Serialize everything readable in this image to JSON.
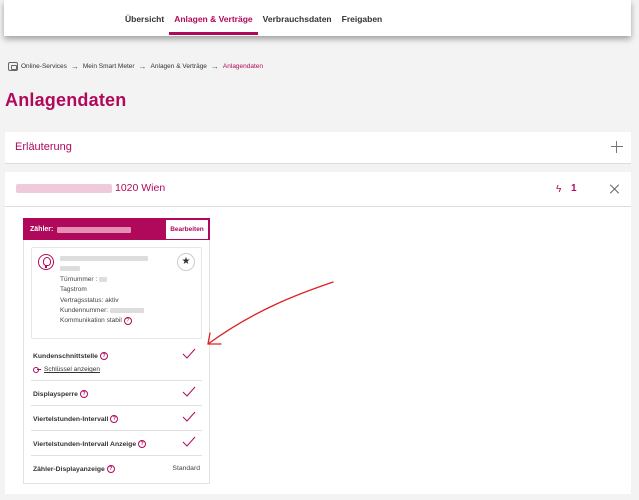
{
  "nav": {
    "items": [
      {
        "label": "Übersicht",
        "active": false
      },
      {
        "label": "Anlagen & Verträge",
        "active": true
      },
      {
        "label": "Verbrauchsdaten",
        "active": false
      },
      {
        "label": "Freigaben",
        "active": false
      }
    ]
  },
  "breadcrumb": {
    "items": [
      "Online-Services",
      "Mein Smart Meter",
      "Anlagen & Verträge",
      "Anlagendaten"
    ]
  },
  "page": {
    "title": "Anlagendaten"
  },
  "explanation": {
    "title": "Erläuterung"
  },
  "location": {
    "address_suffix": "1020 Wien",
    "meter_count": "1"
  },
  "meter": {
    "label": "Zähler:",
    "edit_label": "Bearbeiten",
    "tuernummer_label": "Türnummer :",
    "tarif": "Tagstrom",
    "vertragsstatus": "Vertragsstatus: aktiv",
    "kundennummer_label": "Kundennummer:",
    "kommunikation": "Kommunikation stabil"
  },
  "features": {
    "kundenschnittstelle": "Kundenschnittstelle",
    "schluessel_link": "Schlüssel anzeigen",
    "displaysperre": "Displaysperre",
    "viertelstunden": "Viertelstunden-Intervall",
    "viertelstunden_anzeige": "Viertelstunden-Intervall Anzeige",
    "displayanzeige": "Zähler-Displayanzeige",
    "displayanzeige_value": "Standard"
  },
  "colors": {
    "accent": "#b0095b",
    "annotation": "#e02020"
  }
}
